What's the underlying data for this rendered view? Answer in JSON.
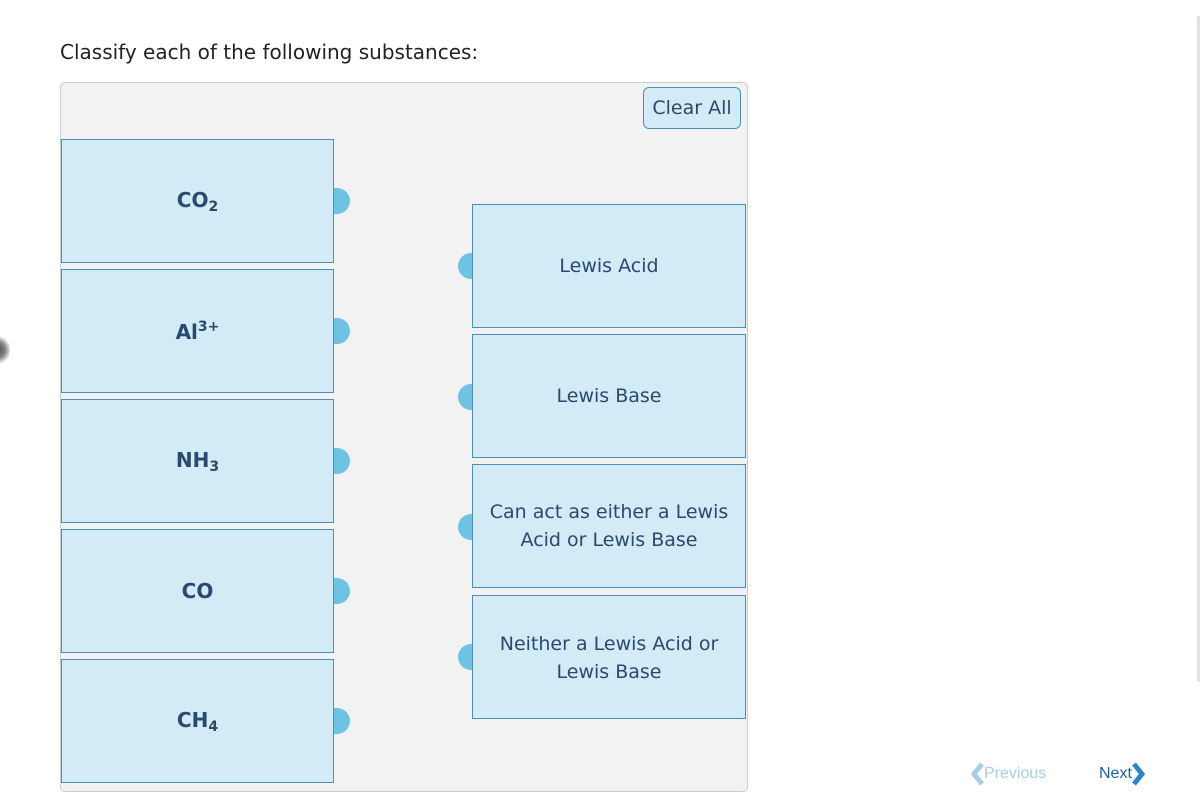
{
  "prompt": "Classify each of the following substances:",
  "clear_all_label": "Clear All",
  "sources": [
    {
      "formula": "CO",
      "sub": "2",
      "sup": ""
    },
    {
      "formula": "Al",
      "sub": "",
      "sup": "3+"
    },
    {
      "formula": "NH",
      "sub": "3",
      "sup": ""
    },
    {
      "formula": "CO",
      "sub": "",
      "sup": ""
    },
    {
      "formula": "CH",
      "sub": "4",
      "sup": ""
    }
  ],
  "targets": [
    {
      "label": "Lewis Acid"
    },
    {
      "label": "Lewis Base"
    },
    {
      "label": "Can act as either a Lewis Acid or Lewis Base"
    },
    {
      "label": "Neither a Lewis Acid or Lewis Base"
    }
  ],
  "nav": {
    "previous_label": "Previous",
    "next_label": "Next"
  },
  "colors": {
    "item_bg": "#d3eaf7",
    "item_border": "#4a8fb5",
    "connector": "#6ec2e2",
    "text": "#284a6e"
  }
}
